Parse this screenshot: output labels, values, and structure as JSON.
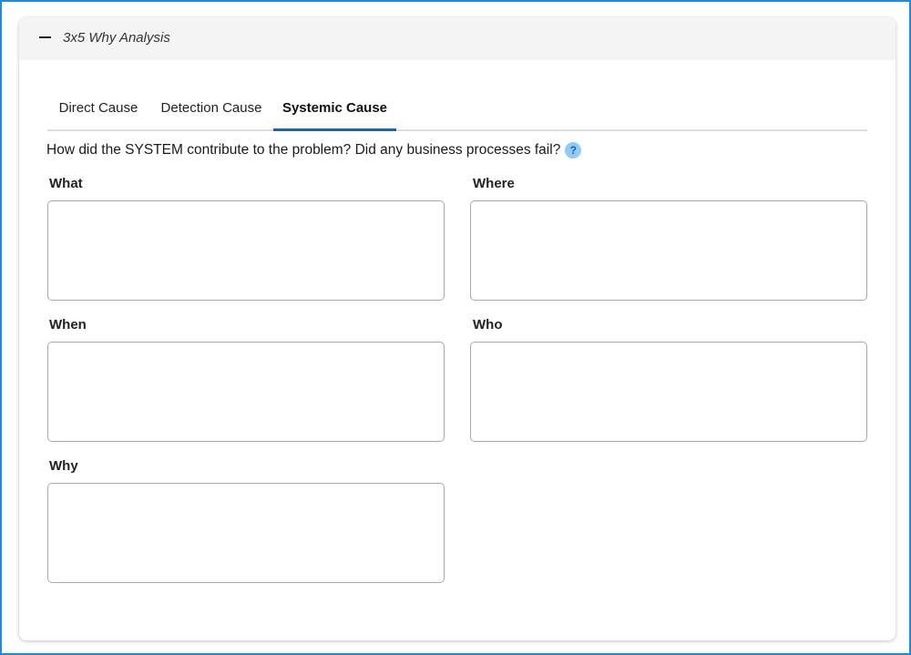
{
  "panel": {
    "title": "3x5 Why Analysis"
  },
  "tabs": [
    {
      "label": "Direct Cause",
      "active": false
    },
    {
      "label": "Detection Cause",
      "active": false
    },
    {
      "label": "Systemic Cause",
      "active": true
    }
  ],
  "question": "How did the SYSTEM contribute to the problem? Did any business processes fail?",
  "help_icon_glyph": "?",
  "fields": {
    "what": {
      "label": "What",
      "value": ""
    },
    "where": {
      "label": "Where",
      "value": ""
    },
    "when": {
      "label": "When",
      "value": ""
    },
    "who": {
      "label": "Who",
      "value": ""
    },
    "why": {
      "label": "Why",
      "value": ""
    }
  },
  "colors": {
    "frame_border": "#1e88e5",
    "active_tab_indicator": "#1565c0",
    "help_icon_bg": "#90caf9",
    "header_bg": "#f4f4f4"
  },
  "icons": {
    "collapse": "minus-icon",
    "help": "question-circle-icon"
  }
}
